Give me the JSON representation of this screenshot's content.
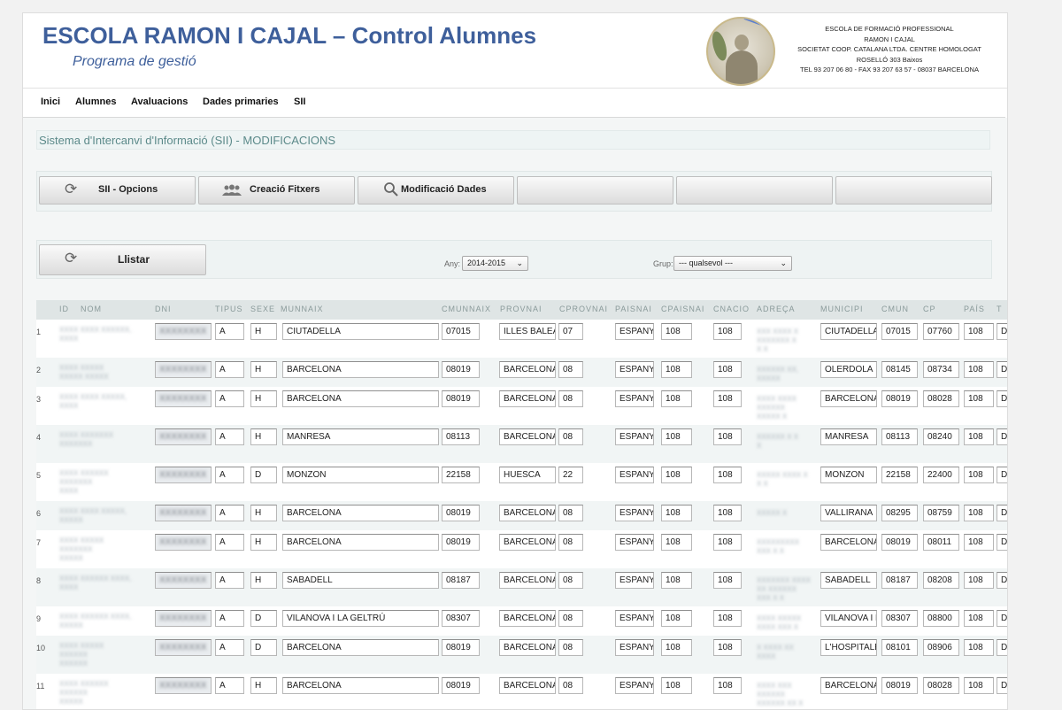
{
  "header": {
    "title": "ESCOLA RAMON I CAJAL – Control Alumnes",
    "subtitle": "Programa de gestió",
    "address_lines": [
      "ESCOLA DE FORMACIÓ PROFESSIONAL",
      "RAMON I CAJAL",
      "SOCIETAT COOP. CATALANA LTDA. CENTRE HOMOLOGAT",
      "ROSELLÓ 303 Baixos",
      "TEL 93 207 06 80 - FAX 93 207 63 57 - 08037 BARCELONA"
    ]
  },
  "menu": [
    "Inici",
    "Alumnes",
    "Avaluacions",
    "Dades primaries",
    "SII"
  ],
  "section_title": "Sistema d'Intercanvi d'Informació (SII) - MODIFICACIONS",
  "tabs": [
    {
      "label": "SII - Opcions",
      "icon": "refresh-icon"
    },
    {
      "label": "Creació Fitxers",
      "icon": "people-icon"
    },
    {
      "label": "Modificació Dades",
      "icon": "search-icon"
    },
    {
      "label": ""
    },
    {
      "label": ""
    },
    {
      "label": ""
    }
  ],
  "list_button": {
    "label": "Llistar",
    "icon": "refresh-icon"
  },
  "filters": {
    "any_label": "Any:",
    "any_value": "2014-2015",
    "grup_label": "Grup:",
    "grup_value": "--- qualsevol ---"
  },
  "table": {
    "columns": [
      "ID",
      "NOM",
      "DNI",
      "TIPUS",
      "SEXE",
      "MUNNAIX",
      "CMUNNAIX",
      "PROVNAI",
      "CPROVNAI",
      "PAISNAI",
      "CPAISNAI",
      "CNACIO",
      "ADREÇA",
      "MUNICIPI",
      "CMUN",
      "CP",
      "PAÍS",
      "T"
    ],
    "rows": [
      {
        "n": "1",
        "tipus": "A",
        "sexe": "H",
        "munnaix": "CIUTADELLA",
        "cmunnaix": "07015",
        "provnai": "ILLES BALEARS",
        "cprovnai": "07",
        "paisnai": "ESPANYA",
        "cpaisnai": "108",
        "cnacio": "108",
        "municipi": "CIUTADELLA",
        "cmun": "07015",
        "cp": "07760",
        "pais": "108",
        "t": "D"
      },
      {
        "n": "2",
        "tipus": "A",
        "sexe": "H",
        "munnaix": "BARCELONA",
        "cmunnaix": "08019",
        "provnai": "BARCELONA",
        "cprovnai": "08",
        "paisnai": "ESPANYA",
        "cpaisnai": "108",
        "cnacio": "108",
        "municipi": "OLERDOLA",
        "cmun": "08145",
        "cp": "08734",
        "pais": "108",
        "t": "D"
      },
      {
        "n": "3",
        "tipus": "A",
        "sexe": "H",
        "munnaix": "BARCELONA",
        "cmunnaix": "08019",
        "provnai": "BARCELONA",
        "cprovnai": "08",
        "paisnai": "ESPANYA",
        "cpaisnai": "108",
        "cnacio": "108",
        "municipi": "BARCELONA",
        "cmun": "08019",
        "cp": "08028",
        "pais": "108",
        "t": "D"
      },
      {
        "n": "4",
        "tipus": "A",
        "sexe": "H",
        "munnaix": "MANRESA",
        "cmunnaix": "08113",
        "provnai": "BARCELONA",
        "cprovnai": "08",
        "paisnai": "ESPANYA",
        "cpaisnai": "108",
        "cnacio": "108",
        "municipi": "MANRESA",
        "cmun": "08113",
        "cp": "08240",
        "pais": "108",
        "t": "D"
      },
      {
        "n": "5",
        "tipus": "A",
        "sexe": "D",
        "munnaix": "MONZON",
        "cmunnaix": "22158",
        "provnai": "HUESCA",
        "cprovnai": "22",
        "paisnai": "ESPANYA",
        "cpaisnai": "108",
        "cnacio": "108",
        "municipi": "MONZON",
        "cmun": "22158",
        "cp": "22400",
        "pais": "108",
        "t": "D"
      },
      {
        "n": "6",
        "tipus": "A",
        "sexe": "H",
        "munnaix": "BARCELONA",
        "cmunnaix": "08019",
        "provnai": "BARCELONA",
        "cprovnai": "08",
        "paisnai": "ESPANYA",
        "cpaisnai": "108",
        "cnacio": "108",
        "municipi": "VALLIRANA",
        "cmun": "08295",
        "cp": "08759",
        "pais": "108",
        "t": "D"
      },
      {
        "n": "7",
        "tipus": "A",
        "sexe": "H",
        "munnaix": "BARCELONA",
        "cmunnaix": "08019",
        "provnai": "BARCELONA",
        "cprovnai": "08",
        "paisnai": "ESPANYA",
        "cpaisnai": "108",
        "cnacio": "108",
        "municipi": "BARCELONA",
        "cmun": "08019",
        "cp": "08011",
        "pais": "108",
        "t": "D"
      },
      {
        "n": "8",
        "tipus": "A",
        "sexe": "H",
        "munnaix": "SABADELL",
        "cmunnaix": "08187",
        "provnai": "BARCELONA",
        "cprovnai": "08",
        "paisnai": "ESPANYA",
        "cpaisnai": "108",
        "cnacio": "108",
        "municipi": "SABADELL",
        "cmun": "08187",
        "cp": "08208",
        "pais": "108",
        "t": "D"
      },
      {
        "n": "9",
        "tipus": "A",
        "sexe": "D",
        "munnaix": "VILANOVA I LA GELTRÚ",
        "cmunnaix": "08307",
        "provnai": "BARCELONA",
        "cprovnai": "08",
        "paisnai": "ESPANYA",
        "cpaisnai": "108",
        "cnacio": "108",
        "municipi": "VILANOVA I LA GELTRÚ",
        "cmun": "08307",
        "cp": "08800",
        "pais": "108",
        "t": "D"
      },
      {
        "n": "10",
        "tipus": "A",
        "sexe": "D",
        "munnaix": "BARCELONA",
        "cmunnaix": "08019",
        "provnai": "BARCELONA",
        "cprovnai": "08",
        "paisnai": "ESPANYA",
        "cpaisnai": "108",
        "cnacio": "108",
        "municipi": "L'HOSPITALET",
        "cmun": "08101",
        "cp": "08906",
        "pais": "108",
        "t": "D"
      },
      {
        "n": "11",
        "tipus": "A",
        "sexe": "H",
        "munnaix": "BARCELONA",
        "cmunnaix": "08019",
        "provnai": "BARCELONA",
        "cprovnai": "08",
        "paisnai": "ESPANYA",
        "cpaisnai": "108",
        "cnacio": "108",
        "municipi": "BARCELONA",
        "cmun": "08019",
        "cp": "08028",
        "pais": "108",
        "t": "D"
      }
    ]
  }
}
